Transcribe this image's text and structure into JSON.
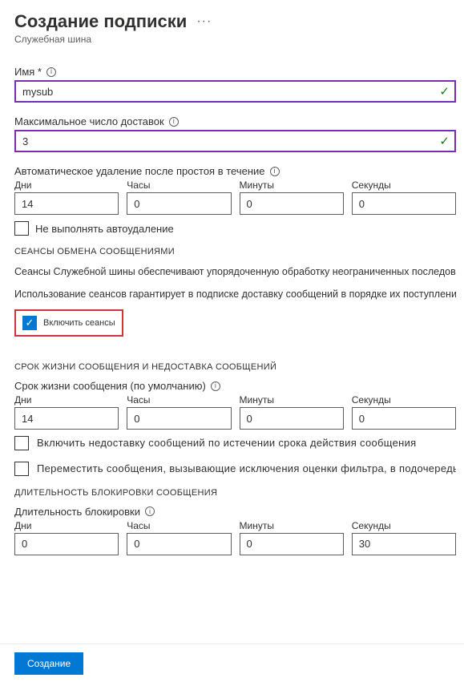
{
  "header": {
    "title": "Создание подписки",
    "subtitle": "Служебная шина"
  },
  "name": {
    "label": "Имя *",
    "value": "mysub"
  },
  "maxDeliveries": {
    "label": "Максимальное число доставок",
    "value": "3"
  },
  "autoDelete": {
    "label": "Автоматическое удаление после простоя в течение",
    "days_label": "Дни",
    "hours_label": "Часы",
    "minutes_label": "Минуты",
    "seconds_label": "Секунды",
    "days": "14",
    "hours": "0",
    "minutes": "0",
    "seconds": "0",
    "noAutoDelete": "Не выполнять автоудаление"
  },
  "sessions": {
    "heading": "СЕАНСЫ ОБМЕНА СООБЩЕНИЯМИ",
    "desc1": "Сеансы Служебной шины обеспечивают упорядоченную обработку неограниченных последовател",
    "desc2": "Использование сеансов гарантирует в подписке доставку сообщений в порядке их поступления. До",
    "enable": "Включить сеансы"
  },
  "ttl": {
    "heading": "СРОК ЖИЗНИ СООБЩЕНИЯ И НЕДОСТАВКА СООБЩЕНИЙ",
    "label": "Срок жизни сообщения (по умолчанию)",
    "days_label": "Дни",
    "hours_label": "Часы",
    "minutes_label": "Минуты",
    "seconds_label": "Секунды",
    "days": "14",
    "hours": "0",
    "minutes": "0",
    "seconds": "0",
    "deadletter": "Включить недоставку сообщений по истечении срока действия сообщения",
    "moveFilter": "Переместить сообщения, вызывающие исключения оценки фильтра, в подочередь"
  },
  "lock": {
    "heading": "ДЛИТЕЛЬНОСТЬ БЛОКИРОВКИ СООБЩЕНИЯ",
    "label": "Длительность блокировки",
    "days_label": "Дни",
    "hours_label": "Часы",
    "minutes_label": "Минуты",
    "seconds_label": "Секунды",
    "days": "0",
    "hours": "0",
    "minutes": "0",
    "seconds": "30"
  },
  "footer": {
    "create": "Создание"
  }
}
